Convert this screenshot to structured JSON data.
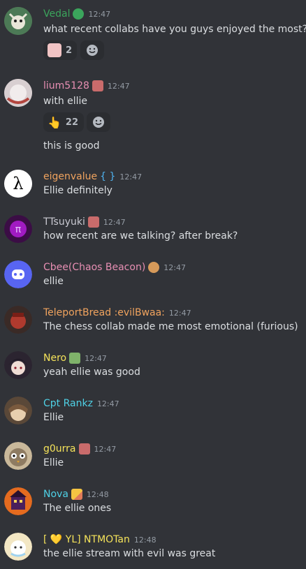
{
  "messages": [
    {
      "author": "Vedal",
      "time": "12:47",
      "text": "what recent collabs have you guys enjoyed the most?",
      "name_color": "#3ba55c",
      "reaction_count": "2"
    },
    {
      "author": "lium5128",
      "time": "12:47",
      "text": "with ellie",
      "text2": "this is good",
      "name_color": "#e78fb3",
      "reaction_count": "22"
    },
    {
      "author": "eigenvalue",
      "time": "12:47",
      "text": "Ellie definitely",
      "name_color": "#f0a35e",
      "badge_text": "{ }"
    },
    {
      "author": "TTsuyuki",
      "time": "12:47",
      "text": "how recent are we talking? after break?",
      "name_color": "#c9c9d1"
    },
    {
      "author": "Cbee(Chaos Beacon)",
      "time": "12:47",
      "text": "ellie",
      "name_color": "#e78fb3"
    },
    {
      "author": "TeleportBread :evilBwaa:",
      "time": "12:47",
      "text": "The chess collab made me most emotional (furious)",
      "name_color": "#f0a35e"
    },
    {
      "author": "Nero",
      "time": "12:47",
      "text": "yeah ellie was good",
      "name_color": "#f5e35a"
    },
    {
      "author": "Cpt Rankz",
      "time": "12:47",
      "text": "Ellie",
      "name_color": "#4fd1e6"
    },
    {
      "author": "g0urra",
      "time": "12:47",
      "text": "Ellie",
      "name_color": "#f5e35a"
    },
    {
      "author": "Nova",
      "time": "12:48",
      "text": "The ellie ones",
      "name_color": "#4fd1e6"
    },
    {
      "author": "[ 💛 YL] NTMOTan",
      "time": "12:48",
      "text": "the ellie stream with evil was great",
      "name_color": "#f5e35a"
    }
  ]
}
